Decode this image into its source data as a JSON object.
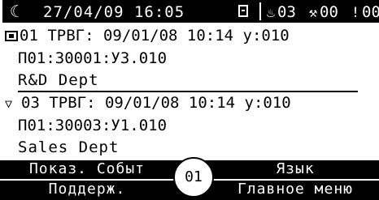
{
  "status": {
    "mode_icon": "moon-icon",
    "datetime": "27/04/09 16:05",
    "fire_count": "03",
    "fault_count": "00",
    "alarm_count": "00"
  },
  "events": [
    {
      "icon": "event-square-icon",
      "line1": "01 ТРВГ: 09/01/08 10:14 у:010",
      "line2": "П01:30001:У3.010",
      "line3": "R&D Dept"
    },
    {
      "icon": "event-triangle-icon",
      "line1": "03 ТРВГ: 09/01/08 10:14 у:010",
      "line2": "П01:30003:У1.010",
      "line3": "Sales Dept"
    }
  ],
  "softkeys": {
    "show_events": "Показ. Событ",
    "support": "Поддерж.",
    "language": "Язык",
    "main_menu": "Главное меню"
  },
  "page_number": "01"
}
